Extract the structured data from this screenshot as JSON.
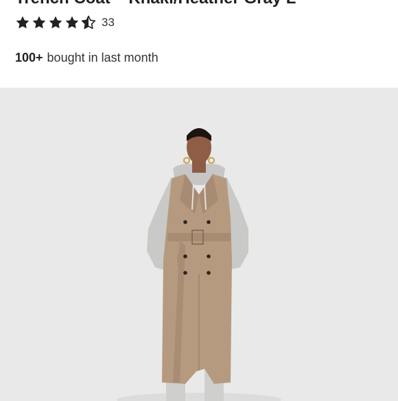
{
  "product": {
    "title": "Trench Coat – Khaki/Heather Gray L",
    "rating_value": 4.5,
    "review_count": "33",
    "bought_count": "100+",
    "bought_text": "bought in last month"
  },
  "colors": {
    "star": "#222222",
    "image_background": "#e9e9e9",
    "coat": "#b59a80",
    "sleeve": "#c9c9c7"
  },
  "icons": {
    "star_full": "star-full-icon",
    "star_half": "star-half-icon"
  }
}
